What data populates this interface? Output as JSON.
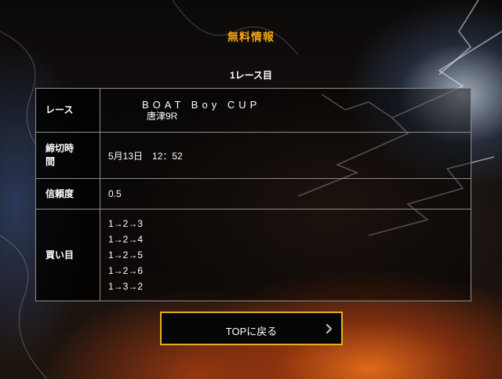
{
  "page": {
    "section_title": "無料情報",
    "race_title": "1レース目"
  },
  "table": {
    "race": {
      "label": "レース",
      "name": "BOAT Boy CUP",
      "venue": "唐津9R"
    },
    "deadline": {
      "label_line1": "締切時",
      "label_line2": "間",
      "value": "5月13日　12：52"
    },
    "confidence": {
      "label": "信頼度",
      "value": "0.5"
    },
    "picks": {
      "label": "買い目",
      "items": [
        "1→2→3",
        "1→2→4",
        "1→2→5",
        "1→2→6",
        "1→3→2"
      ]
    }
  },
  "top_button": {
    "label": "TOPに戻る",
    "icon": "chevron-right-icon"
  },
  "colors": {
    "accent_orange": "#f2a516",
    "button_border": "#e3b01c"
  }
}
